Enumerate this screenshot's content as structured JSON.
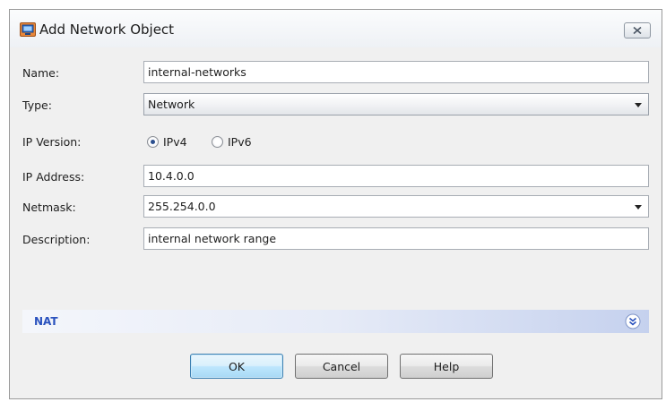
{
  "window": {
    "title": "Add Network Object",
    "app_icon": "network-object-icon",
    "close_icon": "close-icon"
  },
  "form": {
    "name_label": "Name:",
    "name_value": "internal-networks",
    "type_label": "Type:",
    "type_value": "Network",
    "ip_version_label": "IP Version:",
    "ipv4_label": "IPv4",
    "ipv6_label": "IPv6",
    "ip_version_selected": "IPv4",
    "ip_address_label": "IP Address:",
    "ip_address_value": "10.4.0.0",
    "netmask_label": "Netmask:",
    "netmask_value": "255.254.0.0",
    "description_label": "Description:",
    "description_value": "internal network range"
  },
  "nat": {
    "label": "NAT",
    "icon": "expand-chevron-icon"
  },
  "buttons": {
    "ok": "OK",
    "cancel": "Cancel",
    "help": "Help"
  },
  "colors": {
    "accent": "#2a52be",
    "dialog_bg": "#f0f0f0",
    "default_button": "#bee6fd"
  }
}
